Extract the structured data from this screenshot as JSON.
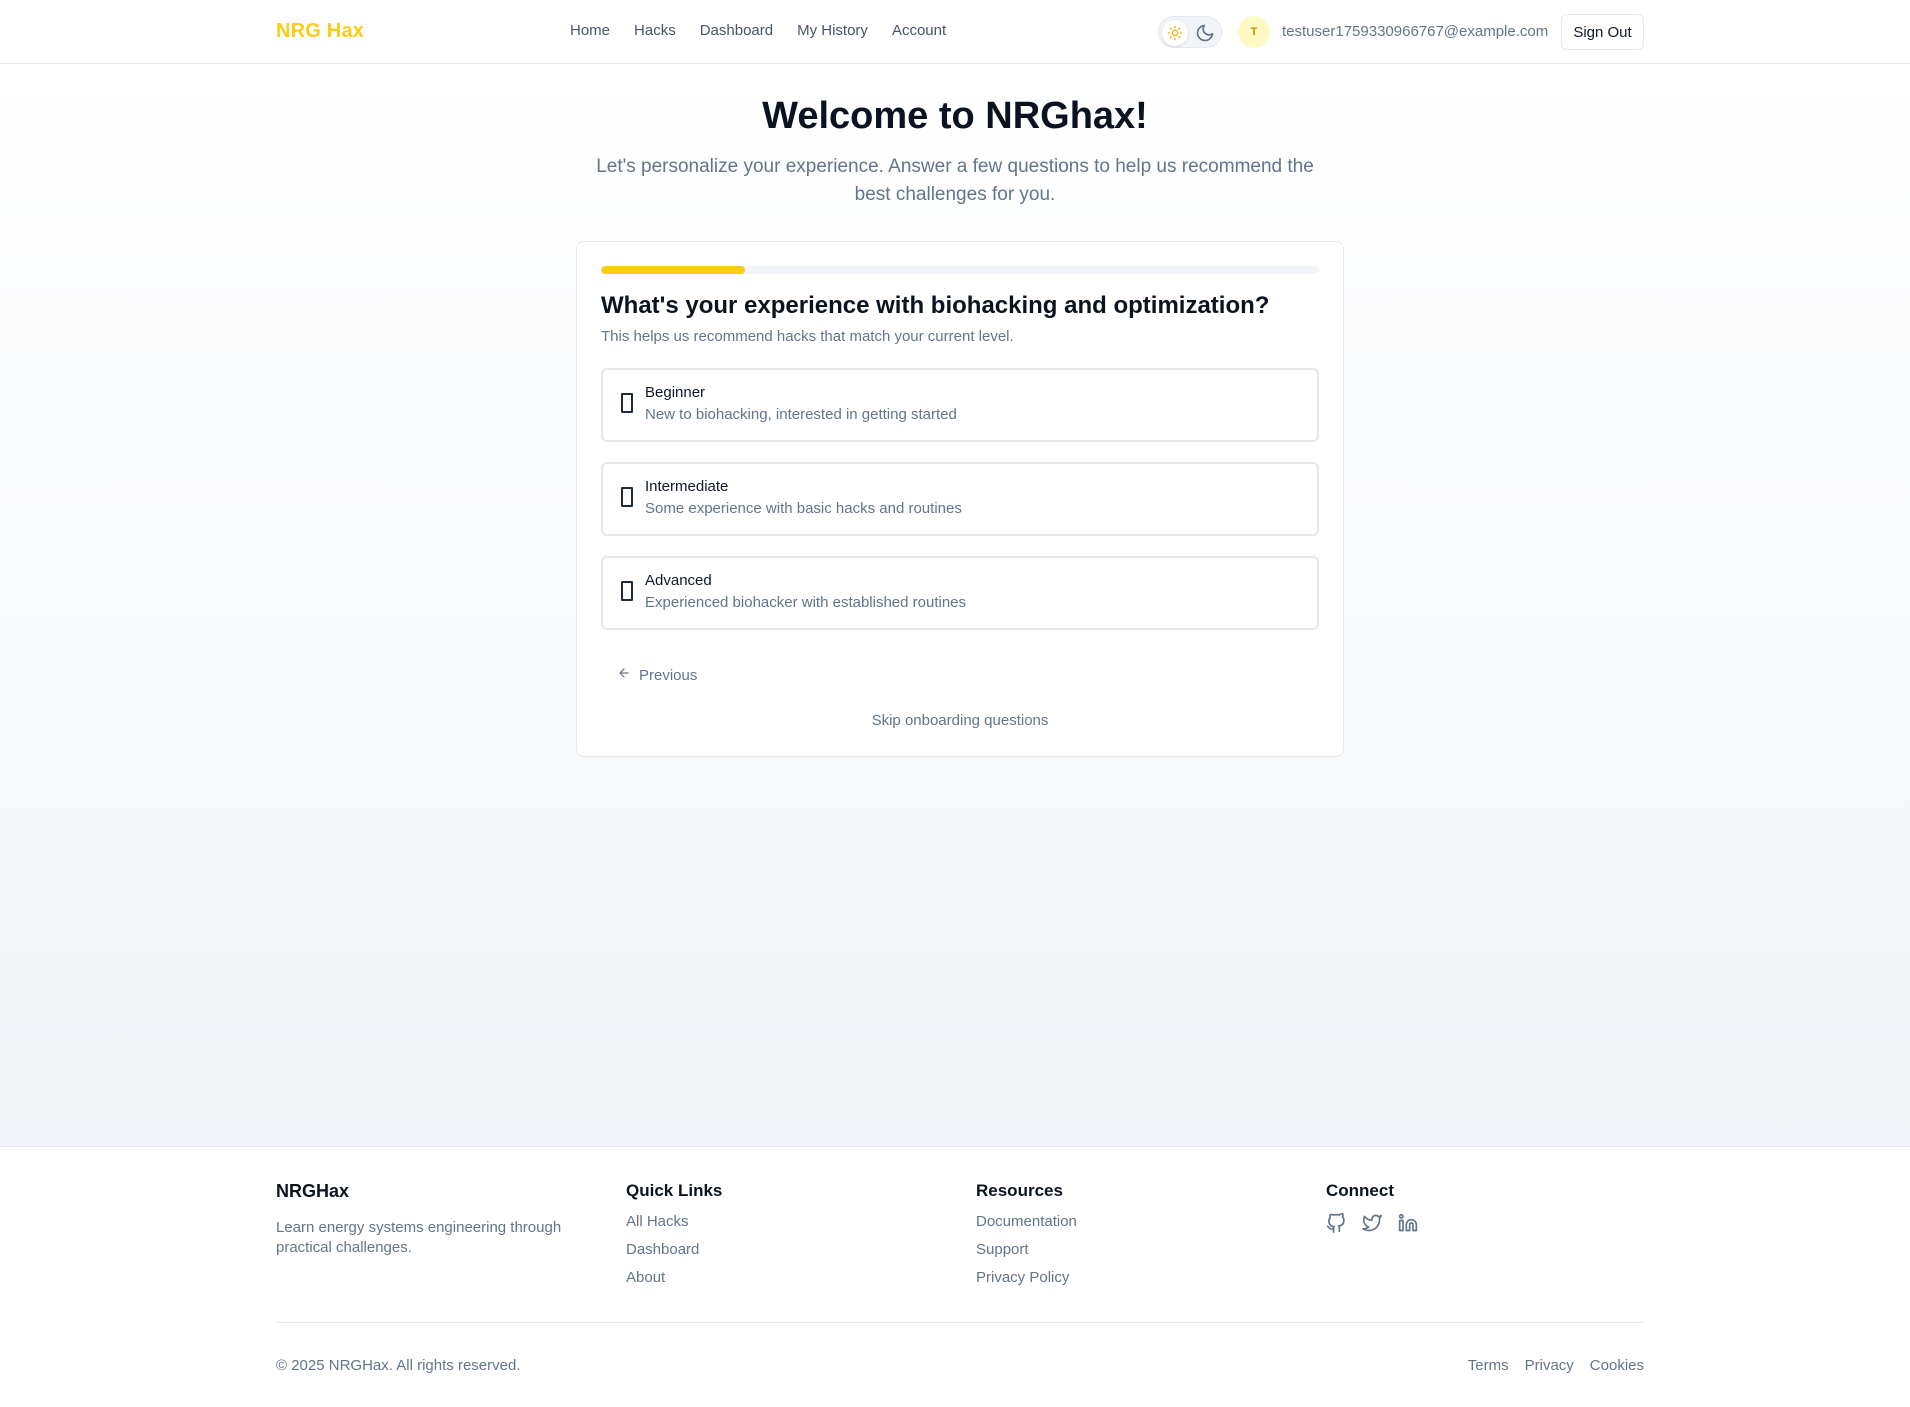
{
  "header": {
    "logo": "NRG Hax",
    "nav": [
      {
        "label": "Home"
      },
      {
        "label": "Hacks"
      },
      {
        "label": "Dashboard"
      },
      {
        "label": "My History"
      },
      {
        "label": "Account"
      }
    ],
    "theme_icons": {
      "light": "sun-icon",
      "dark": "moon-icon"
    },
    "avatar_initial": "T",
    "user_email": "testuser1759330966767@example.com",
    "sign_out_label": "Sign Out"
  },
  "onboarding": {
    "title": "Welcome to NRGhax!",
    "subtitle": "Let's personalize your experience. Answer a few questions to help us recommend the best challenges for you.",
    "progress_fraction": 0.2,
    "question": "What's your experience with biohacking and optimization?",
    "question_desc": "This helps us recommend hacks that match your current level.",
    "options": [
      {
        "label": "Beginner",
        "desc": "New to biohacking, interested in getting started"
      },
      {
        "label": "Intermediate",
        "desc": "Some experience with basic hacks and routines"
      },
      {
        "label": "Advanced",
        "desc": "Experienced biohacker with established routines"
      }
    ],
    "previous_label": "Previous",
    "skip_label": "Skip onboarding questions"
  },
  "footer": {
    "brand": "NRGHax",
    "brand_desc": "Learn energy systems engineering through practical challenges.",
    "quick_links": {
      "heading": "Quick Links",
      "items": [
        "All Hacks",
        "Dashboard",
        "About"
      ]
    },
    "resources": {
      "heading": "Resources",
      "items": [
        "Documentation",
        "Support",
        "Privacy Policy"
      ]
    },
    "connect": {
      "heading": "Connect",
      "icons": [
        "github-icon",
        "twitter-icon",
        "linkedin-icon"
      ]
    },
    "copyright": "© 2025 NRGHax. All rights reserved.",
    "legal": [
      "Terms",
      "Privacy",
      "Cookies"
    ]
  },
  "colors": {
    "accent": "#facc15",
    "text_primary": "#0b1220",
    "text_muted": "#64748b",
    "border": "#e5e7eb"
  }
}
